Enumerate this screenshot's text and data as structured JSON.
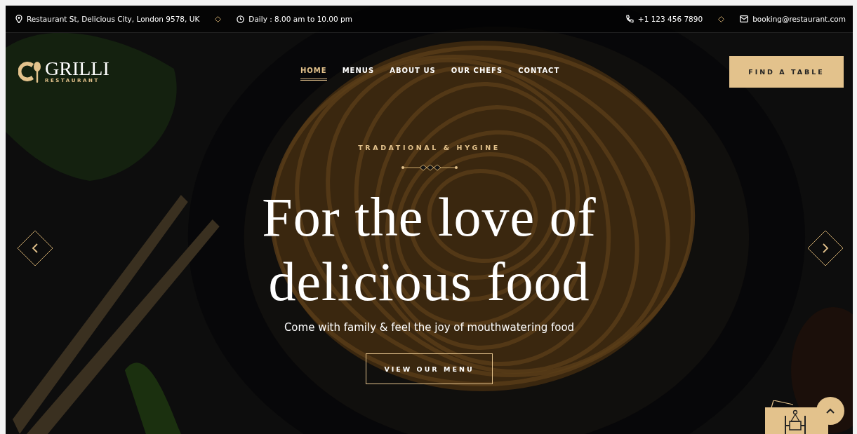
{
  "top_bar": {
    "address": "Restaurant St, Delicious City, London 9578, UK",
    "hours": "Daily : 8.00 am to 10.00 pm",
    "phone": "+1 123 456 7890",
    "email": "booking@restaurant.com"
  },
  "logo": {
    "name": "GRILLI",
    "tagline": "RESTAURANT"
  },
  "nav": [
    {
      "label": "HOME",
      "selected": true
    },
    {
      "label": "MENUS",
      "selected": false
    },
    {
      "label": "ABOUT US",
      "selected": false
    },
    {
      "label": "OUR CHEFS",
      "selected": false
    },
    {
      "label": "CONTACT",
      "selected": false
    }
  ],
  "cta": "FIND A TABLE",
  "hero": {
    "subtitle": "TRADATIONAL & HYGINE",
    "title": [
      "For the love of",
      "delicious food"
    ],
    "text": "Come with family & feel the joy of mouthwatering food",
    "button": "VIEW OUR MENU"
  }
}
